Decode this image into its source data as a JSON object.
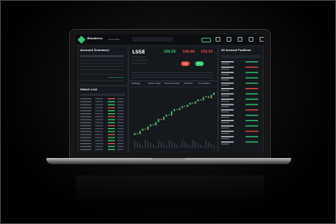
{
  "app": {
    "name": "Blueberry",
    "account_selector": "Accounts"
  },
  "search": {
    "placeholder": ""
  },
  "account_summary": {
    "title": "Account Summary"
  },
  "watchlist": {
    "title": "Watch List"
  },
  "quote": {
    "symbol": "LSSE",
    "price": "250.55",
    "bid": "248.90",
    "ask": "250.55",
    "sell_label": "Sell",
    "buy_label": "Buy"
  },
  "chart_toolbar": {
    "items": [
      "Strategy",
      "Option Chain",
      "Financial Chart",
      "Portfolio",
      "Live Orders"
    ]
  },
  "positions": {
    "title": "All Account Positions"
  },
  "colors": {
    "accent": "#2ecc71",
    "sell": "#e74c3c",
    "screen_bg": "#0f1114"
  },
  "chart_data": {
    "type": "line",
    "title": "",
    "xlabel": "",
    "ylabel": "",
    "series": [
      {
        "values": [
          30,
          32,
          31,
          34,
          36,
          35,
          38,
          40,
          39,
          42,
          45,
          44,
          47,
          49,
          48,
          52,
          54,
          53,
          55,
          57,
          56,
          58,
          60,
          59,
          61,
          63,
          62,
          65,
          66,
          64,
          67,
          69
        ]
      }
    ]
  }
}
